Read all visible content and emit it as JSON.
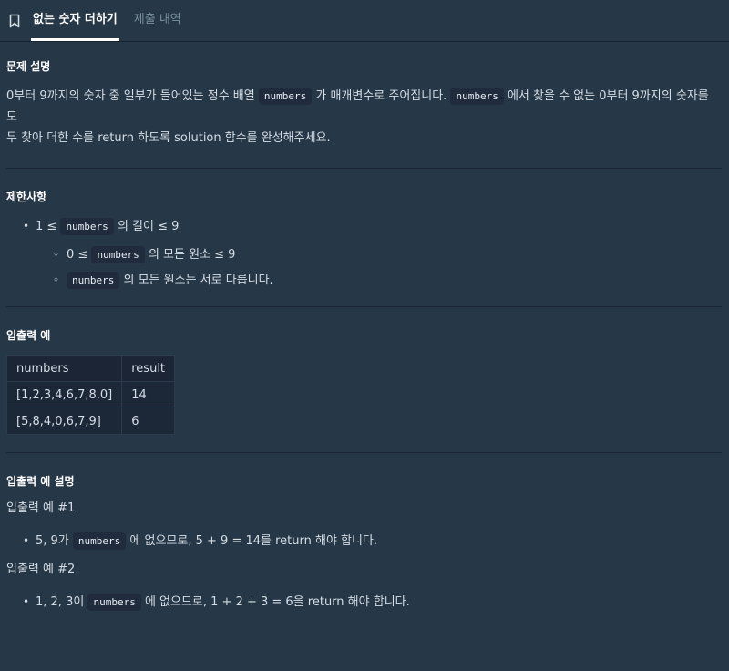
{
  "tabs": [
    {
      "label": "없는 숫자 더하기"
    },
    {
      "label": "제출 내역"
    }
  ],
  "description": {
    "title": "문제 설명",
    "line1_a": "0부터 9까지의 숫자 중 일부가 들어있는 정수 배열",
    "code": "numbers",
    "line1_b": "가 매개변수로 주어집니다.",
    "line1_c": "에서 찾을 수 없는 0부터 9까지의 숫자를 모",
    "line2": "두 찾아 더한 수를 return 하도록 solution 함수를 완성해주세요."
  },
  "constraints": {
    "title": "제한사항",
    "item1_a": "1 ≤",
    "item1_b": "의 길이 ≤ 9",
    "sub1_a": "0 ≤",
    "sub1_b": "의 모든 원소 ≤ 9",
    "sub2_b": "의 모든 원소는 서로 다릅니다."
  },
  "examples": {
    "title": "입출력 예",
    "headers": [
      "numbers",
      "result"
    ],
    "rows": [
      [
        "[1,2,3,4,6,7,8,0]",
        "14"
      ],
      [
        "[5,8,4,0,6,7,9]",
        "6"
      ]
    ]
  },
  "explanation": {
    "title": "입출력 예 설명",
    "ex1_title": "입출력 예 #1",
    "ex1_a": "5, 9가",
    "ex1_b": "에 없으므로, 5 + 9 = 14를 return 해야 합니다.",
    "ex2_title": "입출력 예 #2",
    "ex2_a": "1, 2, 3이",
    "ex2_b": "에 없으므로, 1 + 2 + 3 = 6을 return 해야 합니다."
  },
  "icons": {
    "bookmark": "bookmark-icon"
  },
  "colors": {
    "background": "#263747",
    "code_bg": "#202b3d",
    "table_bg": "#1c2738"
  }
}
